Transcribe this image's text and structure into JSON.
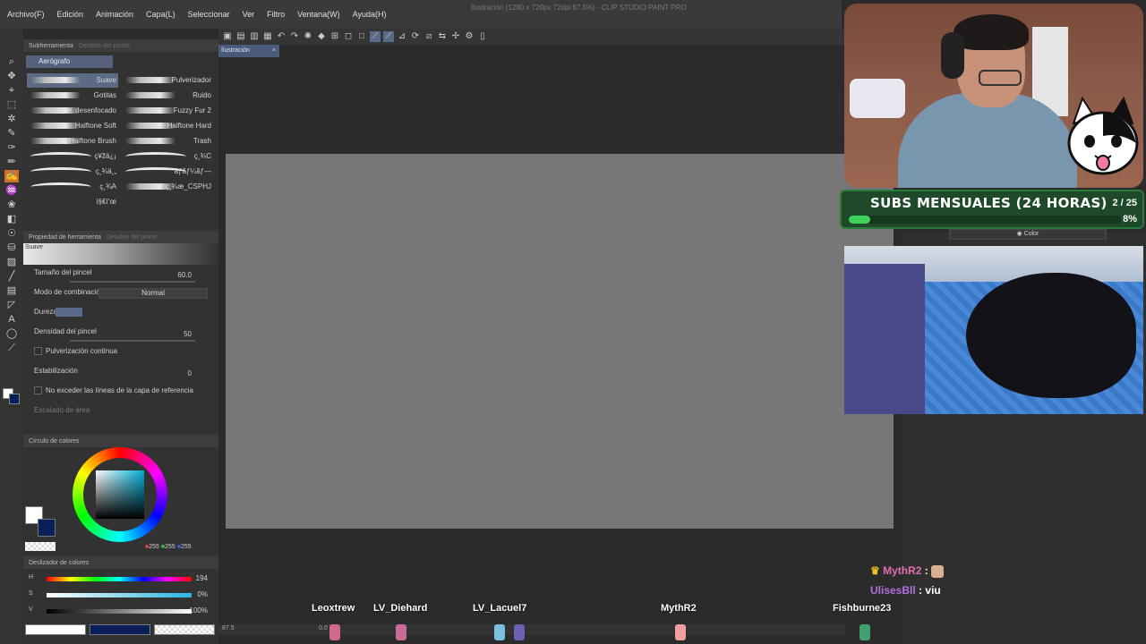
{
  "app": {
    "title": "Ilustración (1280 x 720px 72dpi 87.5%) - CLIP STUDIO PAINT PRO",
    "menus": [
      "Archivo(F)",
      "Edición",
      "Animación",
      "Capa(L)",
      "Seleccionar",
      "Ver",
      "Filtro",
      "Ventana(W)",
      "Ayuda(H)"
    ]
  },
  "canvas": {
    "tab_label": "Ilustración",
    "zoom": "87.5",
    "rotation": "0.0"
  },
  "subtool_panel": {
    "header_active": "Subherramienta",
    "header_inactive": "Detalles del pincel",
    "group": "Aerógrafo",
    "brushes": [
      {
        "label": "Suave",
        "selected": true
      },
      {
        "label": "Pulverizador",
        "selected": false
      },
      {
        "label": "Gotitas",
        "selected": false
      },
      {
        "label": "Ruido",
        "selected": false
      },
      {
        "label": "Pulver. desenfocado",
        "selected": false
      },
      {
        "label": "Fuzzy Fur 2",
        "selected": false
      },
      {
        "label": "Halftone Soft",
        "selected": false
      },
      {
        "label": "Halftone Hard",
        "selected": false
      },
      {
        "label": "Halftone Brush",
        "selected": false
      },
      {
        "label": "Trash",
        "selected": false
      },
      {
        "label": "ç¥žä¿¡",
        "selected": false
      },
      {
        "label": "ç¸¾C",
        "selected": false
      },
      {
        "label": "ç¸¾ä¸„",
        "selected": false
      },
      {
        "label": "ãƒ­ãƒ¼ãƒ—",
        "selected": false
      },
      {
        "label": "ç¸¾A",
        "selected": false
      },
      {
        "label": "ç¸¾æ_CSPHJ",
        "selected": false
      },
      {
        "label": "ì§€í‘œ",
        "selected": false
      }
    ]
  },
  "tool_property": {
    "header_active": "Propiedad de herramienta",
    "header_inactive": "Detalles del pincel",
    "preview_label": "Suave",
    "brush_size_label": "Tamaño del pincel",
    "brush_size_value": "60.0",
    "blend_mode_label": "Modo de combinación",
    "blend_mode_value": "Normal",
    "hardness_label": "Dureza",
    "density_label": "Densidad del pincel",
    "density_value": "50",
    "continuous_spray_label": "Pulverización continua",
    "stabilization_label": "Estabilización",
    "stabilization_value": "0",
    "no_exceed_label": "No exceder las líneas de la capa de referencia",
    "area_scaling_label": "Escalado de área"
  },
  "color_wheel": {
    "header": "Círculo de colores",
    "r": "255",
    "g": "255",
    "b": "255",
    "main_color": "#ffffff",
    "sub_color": "#0a1e5a"
  },
  "color_slider": {
    "header": "Deslizador de colores",
    "h_label": "H",
    "h_value": "194",
    "s_label": "S",
    "s_value": "0%",
    "v_label": "V",
    "v_value": "100%"
  },
  "right_panel": {
    "color_select": "Color"
  },
  "overlay": {
    "subgoal_title": "SUBS MENSUALES (24 HORAS)",
    "subgoal_count": "2 / 25",
    "subgoal_pct": "8%",
    "subgoal_fraction": 0.08
  },
  "chat": [
    {
      "user": "MythR2",
      "sep": ":",
      "msg": ""
    },
    {
      "user": "UlisesBll",
      "sep": ":",
      "msg": "viu"
    }
  ],
  "viewers": [
    "Leoxtrew",
    "LV_Diehard",
    "LV_Lacuel7",
    "MythR2",
    "Fishburne23"
  ]
}
